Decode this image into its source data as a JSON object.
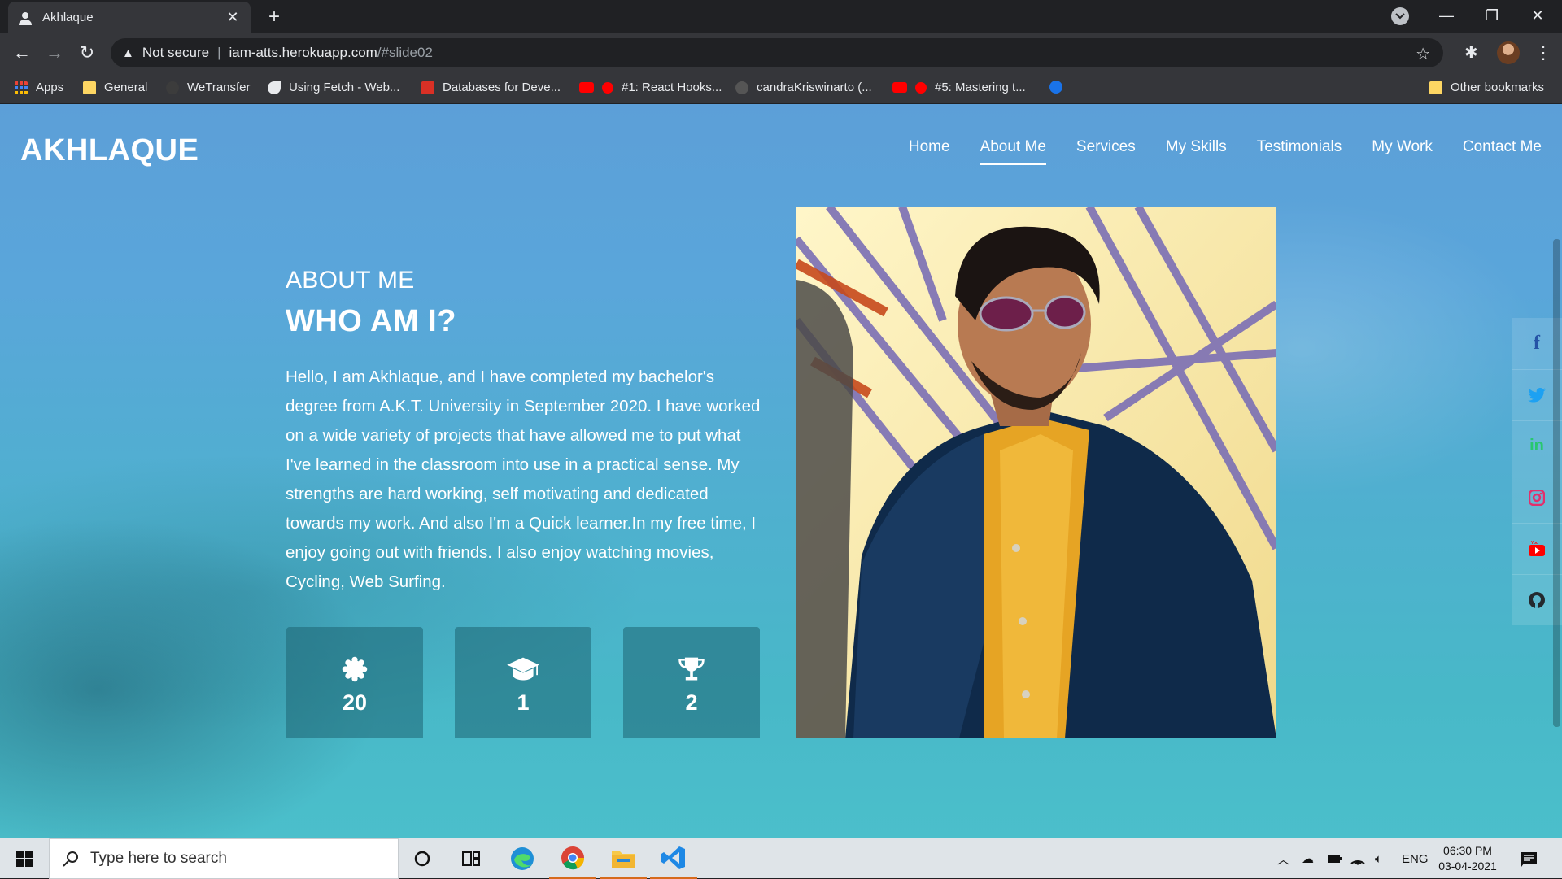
{
  "browser": {
    "tab_title": "Akhlaque",
    "tab_close": "✕",
    "new_tab": "+",
    "url_warning": "Not secure",
    "url_host": "iam-atts.herokuapp.com",
    "url_path": "/#slide02",
    "window_controls": {
      "minimize": "—",
      "restore": "❐",
      "close": "✕"
    }
  },
  "bookmarks": [
    {
      "label": "Apps",
      "icon": "apps-grid-icon",
      "color": "#e8eaed"
    },
    {
      "label": "General",
      "icon": "folder-icon",
      "color": "#fdd663"
    },
    {
      "label": "WeTransfer",
      "icon": "wetransfer-icon",
      "color": "#444"
    },
    {
      "label": "Using Fetch - Web...",
      "icon": "mdn-icon",
      "color": "#e8eaed"
    },
    {
      "label": "Databases for Deve...",
      "icon": "databases-icon",
      "color": "#d93025"
    },
    {
      "label": "#1: React Hooks...",
      "icon": "youtube-icon",
      "color": "#ff0000"
    },
    {
      "label": "candraKriswinarto (...",
      "icon": "github-icon",
      "color": "#555"
    },
    {
      "label": "#5: Mastering t...",
      "icon": "youtube-icon",
      "color": "#ff0000"
    }
  ],
  "other_bookmarks": "Other bookmarks",
  "site": {
    "brand": "AKHLAQUE",
    "nav": [
      "Home",
      "About Me",
      "Services",
      "My Skills",
      "Testimonials",
      "My Work",
      "Contact Me"
    ],
    "active_nav": "About Me",
    "section_label": "ABOUT ME",
    "heading": "WHO AM I?",
    "bio": "Hello, I am Akhlaque, and I have completed my bachelor's degree from A.K.T. University in September 2020. I have worked on a wide variety of projects that have allowed me to put what I've learned in the classroom into use in a practical sense. My strengths are hard working, self motivating and dedicated towards my work. And also I'm a Quick learner.In my free time, I enjoy going out with friends. I also enjoy watching movies, Cycling, Web Surfing.",
    "stats": [
      {
        "icon": "badge-icon",
        "value": "20"
      },
      {
        "icon": "graduation-cap-icon",
        "value": "1"
      },
      {
        "icon": "trophy-icon",
        "value": "2"
      }
    ],
    "social": [
      {
        "name": "facebook-icon",
        "glyph": "f",
        "color": "#3b5998"
      },
      {
        "name": "twitter-icon",
        "glyph": "t",
        "color": "#1da1f2"
      },
      {
        "name": "linkedin-icon",
        "glyph": "in",
        "color": "#28c76f"
      },
      {
        "name": "instagram-icon",
        "glyph": "◎",
        "color": "#e1306c"
      },
      {
        "name": "youtube-icon",
        "glyph": "▶",
        "color": "#ff0000"
      },
      {
        "name": "github-icon",
        "glyph": "●",
        "color": "#24292e"
      }
    ]
  },
  "taskbar": {
    "search_placeholder": "Type here to search",
    "language": "ENG",
    "time": "06:30 PM",
    "date": "03-04-2021"
  }
}
